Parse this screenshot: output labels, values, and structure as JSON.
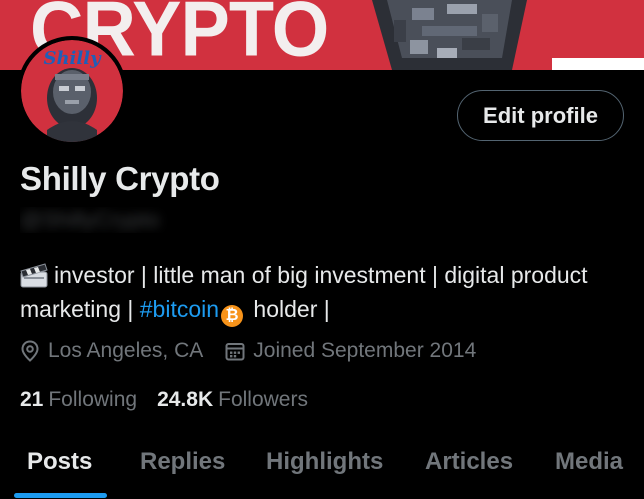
{
  "banner": {
    "text": "CRYPTO",
    "bg_color": "#d1313f"
  },
  "avatar": {
    "text": "Shilly",
    "ring_color": "#d1313f"
  },
  "profile": {
    "edit_label": "Edit profile",
    "display_name": "Shilly Crypto",
    "handle": "@ShillyCrypto",
    "bio_part1": "investor | little man of big investment | digital product marketing |",
    "bio_hashtag": "#bitcoin",
    "bio_part2": "holder |",
    "btc_symbol": "₿",
    "location": "Los Angeles, CA",
    "joined": "Joined September 2014"
  },
  "stats": {
    "following_count": "21",
    "following_label": "Following",
    "followers_count": "24.8K",
    "followers_label": "Followers"
  },
  "tabs": [
    {
      "label": "Posts",
      "active": true
    },
    {
      "label": "Replies",
      "active": false
    },
    {
      "label": "Highlights",
      "active": false
    },
    {
      "label": "Articles",
      "active": false
    },
    {
      "label": "Media",
      "active": false
    }
  ],
  "colors": {
    "accent": "#1d9bf0",
    "text_primary": "#e7e9ea",
    "text_secondary": "#71767b",
    "bitcoin": "#f7931a"
  }
}
